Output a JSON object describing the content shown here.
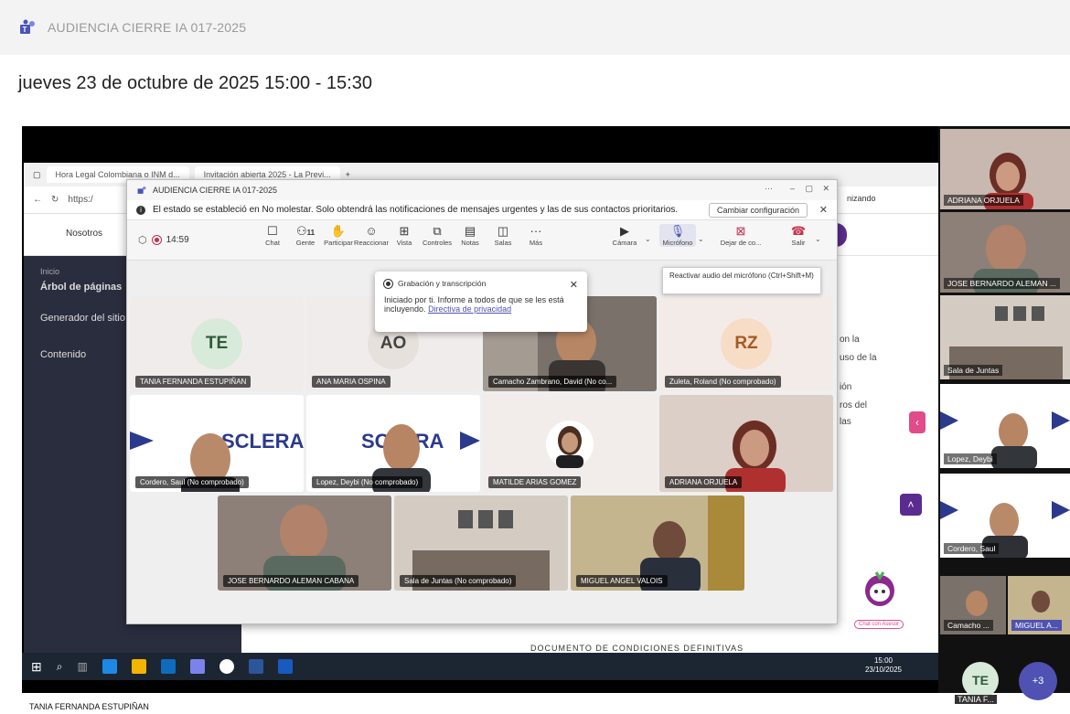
{
  "meeting": {
    "title": "AUDIENCIA CIERRE IA 017-2025",
    "datetime": "jueves 23 de octubre de 2025 15:00 - 15:30"
  },
  "browser": {
    "tab1": "Hora Legal Colombiana o INM d...",
    "tab2": "Invitación abierta 2025 - La Previ...",
    "address": "https:/",
    "nav_label": "Nosotros",
    "sync_label": "nizando"
  },
  "sidebar": {
    "items": [
      {
        "label": "Inicio"
      },
      {
        "label": "Árbol de páginas"
      },
      {
        "label": "Generador del sitio"
      },
      {
        "label": "Contenido"
      }
    ]
  },
  "page_fragments": {
    "text1": "on la",
    "text2": "uso de la",
    "text3": "ión",
    "text4": "ros del",
    "text5": "las",
    "footer": "DOCUMENTO DE CONDICIONES DEFINITIVAS",
    "chat_badge": "Chat con Asesor"
  },
  "teams": {
    "window_title": "AUDIENCIA CIERRE IA 017-2025",
    "notice": "El estado se estableció en No molestar. Solo obtendrá las notificaciones de mensajes urgentes y las de sus contactos prioritarios.",
    "notice_button": "Cambiar configuración",
    "timer": "14:59",
    "toolbar": [
      {
        "label": "Chat",
        "icon": "chat-icon"
      },
      {
        "label": "Gente",
        "count": "11",
        "icon": "people-icon"
      },
      {
        "label": "Participar",
        "icon": "raise-hand-icon"
      },
      {
        "label": "Reaccionar",
        "icon": "emoji-icon"
      },
      {
        "label": "Vista",
        "icon": "grid-icon"
      },
      {
        "label": "Controles",
        "icon": "share-icon"
      },
      {
        "label": "Notas",
        "icon": "notes-icon"
      },
      {
        "label": "Salas",
        "icon": "rooms-icon"
      },
      {
        "label": "Más",
        "icon": "more-icon"
      }
    ],
    "camera_label": "Cámara",
    "mic_label": "Micrófono",
    "share_label": "Dejar de co...",
    "leave_label": "Salir",
    "recording_popup": {
      "heading": "Grabación y transcripción",
      "body": "Iniciado por ti. Informe a todos de que se les está incluyendo.",
      "link": "Directiva de privacidad"
    },
    "tooltip": "Reactivar audio del micrófono (Ctrl+Shift+M)",
    "participants": [
      {
        "name": "TANIA FERNANDA ESTUPIÑAN",
        "initials": "TE"
      },
      {
        "name": "ANA MARIA OSPINA",
        "initials": "AO"
      },
      {
        "name": "Camacho Zambrano, David (No co..."
      },
      {
        "name": "Zuleta, Roland (No comprobado)",
        "initials": "RZ"
      },
      {
        "name": "Cordero, Saul (No comprobado)"
      },
      {
        "name": "Lopez, Deybi (No comprobado)"
      },
      {
        "name": "MATILDE ARIAS GOMEZ"
      },
      {
        "name": "ADRIANA ORJUELA"
      },
      {
        "name": "JOSE BERNARDO ALEMAN CABANA"
      },
      {
        "name": "Sala de Juntas (No comprobado)"
      },
      {
        "name": "MIGUEL ANGEL VALOIS"
      }
    ]
  },
  "taskbar": {
    "time": "15:00",
    "date": "23/10/2025"
  },
  "right_panel": {
    "tiles": [
      {
        "name": "ADRIANA ORJUELA"
      },
      {
        "name": "JOSE BERNARDO ALEMAN ..."
      },
      {
        "name": "Sala de Juntas"
      },
      {
        "name": "Lopez, Deybi"
      },
      {
        "name": "Cordero, Saul"
      },
      {
        "name": "Camacho ..."
      },
      {
        "name": "MIGUEL A..."
      }
    ],
    "self_initials": "TE",
    "self_name": "TANIA F...",
    "more_count": "+3"
  },
  "bottom_name": "TANIA FERNANDA ESTUPIÑAN",
  "sclera_brand": "SCLERA"
}
